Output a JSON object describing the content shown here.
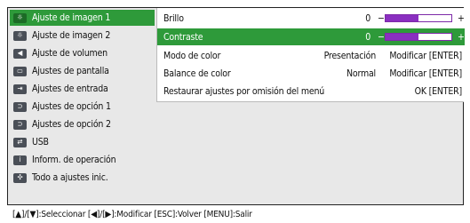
{
  "left_menu": {
    "items": [
      {
        "label": "Ajuste de imagen 1",
        "icon": "image-adjust-icon",
        "glyph": "☼",
        "selected": true
      },
      {
        "label": "Ajuste de imagen 2",
        "icon": "image-adjust-icon",
        "glyph": "☼",
        "selected": false
      },
      {
        "label": "Ajuste de volumen",
        "icon": "volume-icon",
        "glyph": "◀",
        "selected": false
      },
      {
        "label": "Ajustes de pantalla",
        "icon": "screen-icon",
        "glyph": "▭",
        "selected": false
      },
      {
        "label": "Ajustes de entrada",
        "icon": "input-icon",
        "glyph": "⇥",
        "selected": false
      },
      {
        "label": "Ajustes de opción 1",
        "icon": "option-icon",
        "glyph": "⊃",
        "selected": false
      },
      {
        "label": "Ajustes de opción 2",
        "icon": "option-icon",
        "glyph": "⊃",
        "selected": false
      },
      {
        "label": "USB",
        "icon": "usb-icon",
        "glyph": "⇄",
        "selected": false
      },
      {
        "label": "Inform. de operación",
        "icon": "info-icon",
        "glyph": "i",
        "selected": false
      },
      {
        "label": "Todo a ajustes inic.",
        "icon": "reset-icon",
        "glyph": "✣",
        "selected": false
      }
    ]
  },
  "right_panel": {
    "rows": [
      {
        "label": "Brillo",
        "value": "0",
        "minus": "−",
        "plus": "+",
        "bar_fraction": 0.5,
        "selected": false
      },
      {
        "label": "Contraste",
        "value": "0",
        "minus": "−",
        "plus": "+",
        "bar_fraction": 0.5,
        "selected": true
      },
      {
        "label": "Modo de color",
        "current": "Presentación",
        "action": "Modificar [ENTER]",
        "selected": false
      },
      {
        "label": "Balance de color",
        "current": "Normal",
        "action": "Modificar [ENTER]",
        "selected": false
      },
      {
        "label": "Restaurar ajustes por omisión del menú",
        "action": "OK [ENTER]",
        "selected": false
      }
    ]
  },
  "bottom_bar": {
    "help_text": "[▲]/[▼]:Seleccionar [◀]/[▶]:Modificar [ESC]:Volver [MENU]:Salir"
  },
  "colors": {
    "selection_green": "#2e9a3a",
    "bar_purple": "#8a2fc0",
    "menu_background": "#e8e8e8"
  }
}
